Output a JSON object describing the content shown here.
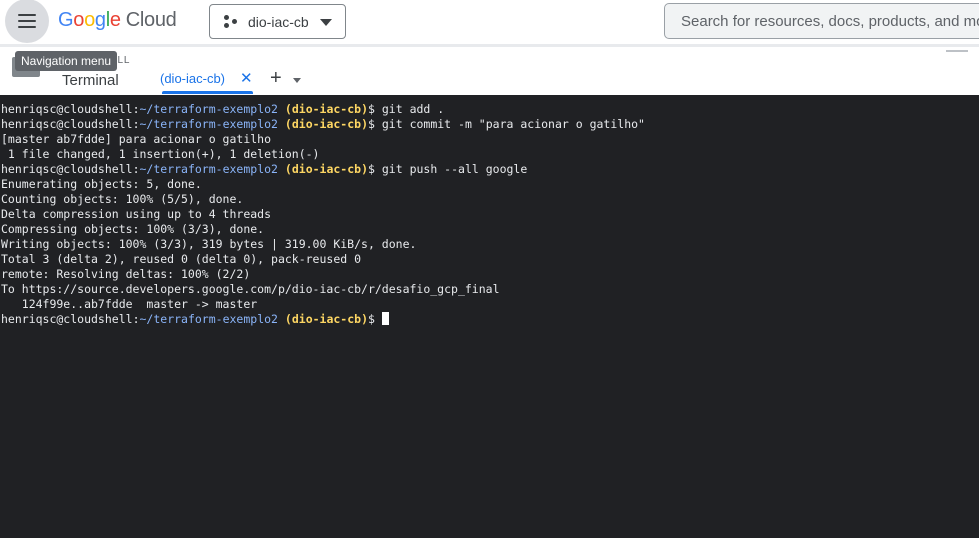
{
  "header": {
    "menu_icon": "hamburger-menu-icon",
    "logo": {
      "letters": [
        "G",
        "o",
        "o",
        "g",
        "l",
        "e"
      ],
      "cloud": "Cloud"
    },
    "project": {
      "icon": "project-hub-icon",
      "name": "dio-iac-cb"
    },
    "search": {
      "placeholder": "Search for resources, docs, products, and more"
    }
  },
  "tooltip": {
    "text": "Navigation menu"
  },
  "shell": {
    "section_label": "ELL",
    "title": "Terminal",
    "tabs": [
      {
        "label": "(dio-iac-cb)",
        "close": "✕"
      }
    ],
    "add_tab": "+"
  },
  "terminal": {
    "prompt": {
      "user": "henriqsc@cloudshell",
      "sep": ":",
      "path": "~/terraform-exemplo2",
      "project": "(dio-iac-cb)",
      "symbol": "$"
    },
    "lines": [
      {
        "kind": "prompt",
        "cmd": "git add ."
      },
      {
        "kind": "prompt",
        "cmd": "git commit -m \"para acionar o gatilho\""
      },
      {
        "kind": "out",
        "text": "[master ab7fdde] para acionar o gatilho"
      },
      {
        "kind": "out",
        "text": " 1 file changed, 1 insertion(+), 1 deletion(-)"
      },
      {
        "kind": "prompt",
        "cmd": "git push --all google"
      },
      {
        "kind": "out",
        "text": "Enumerating objects: 5, done."
      },
      {
        "kind": "out",
        "text": "Counting objects: 100% (5/5), done."
      },
      {
        "kind": "out",
        "text": "Delta compression using up to 4 threads"
      },
      {
        "kind": "out",
        "text": "Compressing objects: 100% (3/3), done."
      },
      {
        "kind": "out",
        "text": "Writing objects: 100% (3/3), 319 bytes | 319.00 KiB/s, done."
      },
      {
        "kind": "out",
        "text": "Total 3 (delta 2), reused 0 (delta 0), pack-reused 0"
      },
      {
        "kind": "out",
        "text": "remote: Resolving deltas: 100% (2/2)"
      },
      {
        "kind": "out",
        "text": "To https://source.developers.google.com/p/dio-iac-cb/r/desafio_gcp_final"
      },
      {
        "kind": "out",
        "text": "   124f99e..ab7fdde  master -> master"
      },
      {
        "kind": "prompt",
        "cmd": "",
        "cursor": true
      }
    ]
  }
}
